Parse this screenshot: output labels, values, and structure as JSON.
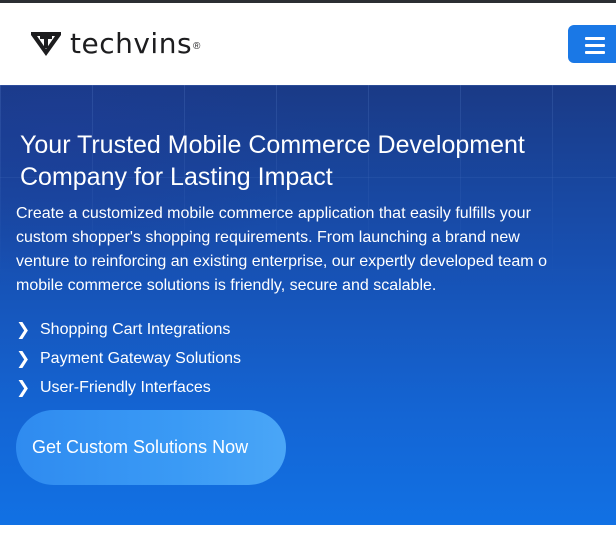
{
  "header": {
    "brand_name": "techvins",
    "brand_reg_mark": "®",
    "menu_icon": "hamburger-menu-icon",
    "menu_color": "#1a78e6"
  },
  "hero": {
    "title_lines": [
      "Your Trusted Mobile Commerce Development",
      "Company for Lasting Impact"
    ],
    "description_lines": [
      "Create a customized mobile commerce application that easily fulfills your",
      "custom shopper's shopping requirements. From launching a brand new",
      "venture to reinforcing an existing enterprise, our expertly developed team o",
      "mobile commerce solutions is friendly, secure and scalable."
    ],
    "features": [
      {
        "icon": "chevron-right-icon",
        "glyph": "❯",
        "label": "Shopping Cart Integrations"
      },
      {
        "icon": "chevron-right-icon",
        "glyph": "❯",
        "label": "Payment Gateway Solutions"
      },
      {
        "icon": "chevron-right-icon",
        "glyph": "❯",
        "label": "User-Friendly Interfaces"
      }
    ],
    "cta_label": "Get Custom Solutions Now",
    "colors": {
      "gradient_top": "#1a3a86",
      "gradient_bottom": "#1171e4",
      "cta": "#3a9af5"
    }
  }
}
